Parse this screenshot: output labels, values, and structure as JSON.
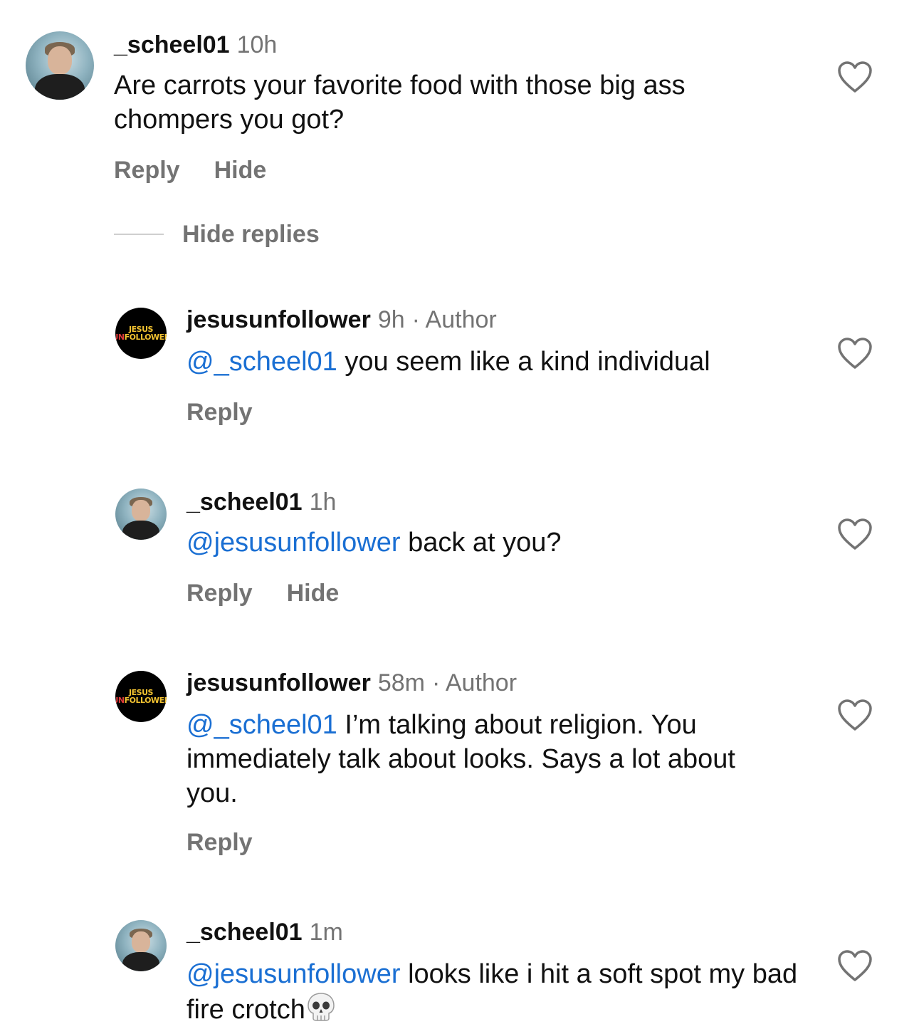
{
  "comments": [
    {
      "username": "_scheel01",
      "time": "10h",
      "text": "Are carrots your favorite food with those big ass chompers you got?",
      "actions": [
        "Reply",
        "Hide"
      ],
      "avatar_icon": "profile-photo"
    },
    {
      "username": "jesusunfollower",
      "time": "9h",
      "author_tag": "· Author",
      "mention": "@_scheel01",
      "text": "you seem like a kind individual",
      "actions": [
        "Reply"
      ],
      "avatar_icon": "jesus-unfollower-logo",
      "logo_line1": "JESUS",
      "logo_line2a": "UN",
      "logo_line2b": "FOLLOWER"
    },
    {
      "username": "_scheel01",
      "time": "1h",
      "mention": "@jesusunfollower",
      "text": "back at you?",
      "actions": [
        "Reply",
        "Hide"
      ],
      "avatar_icon": "profile-photo"
    },
    {
      "username": "jesusunfollower",
      "time": "58m",
      "author_tag": "· Author",
      "mention": "@_scheel01",
      "text": "I’m talking about religion. You immediately talk about looks. Says a lot about you.",
      "actions": [
        "Reply"
      ],
      "avatar_icon": "jesus-unfollower-logo",
      "logo_line1": "JESUS",
      "logo_line2a": "UN",
      "logo_line2b": "FOLLOWER"
    },
    {
      "username": "_scheel01",
      "time": "1m",
      "mention": "@jesusunfollower",
      "text": "looks like i hit a soft spot my bad fire crotch",
      "emoji": "skull-emoji",
      "avatar_icon": "profile-photo"
    }
  ],
  "hide_replies_label": "Hide replies",
  "colors": {
    "mention": "#1a6fd3",
    "muted": "#737373",
    "text": "#111111"
  }
}
